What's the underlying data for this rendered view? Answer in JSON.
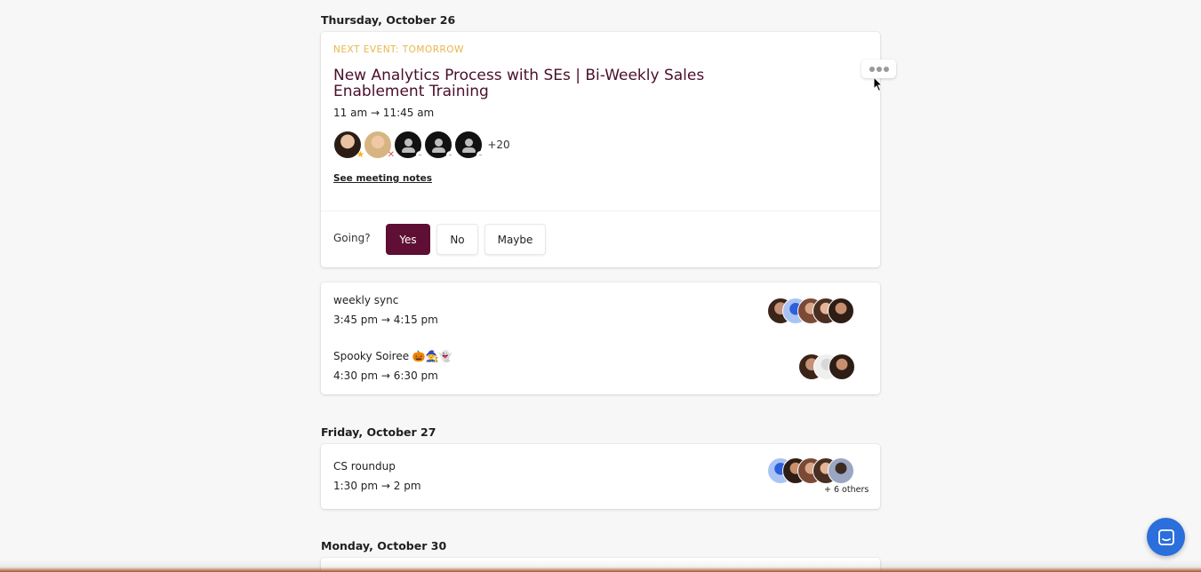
{
  "days": [
    {
      "label": "Thursday, October 26"
    },
    {
      "label": "Friday, October 27"
    },
    {
      "label": "Monday, October 30"
    }
  ],
  "featured": {
    "next_label": "NEXT EVENT: TOMORROW",
    "title": "New Analytics Process with SEs | Bi-Weekly Sales Enablement Training",
    "time": "11 am → 11:45 am",
    "more_attendees": "+20",
    "notes_link": "See meeting notes",
    "going_label": "Going?",
    "rsvp": {
      "yes": "Yes",
      "no": "No",
      "maybe": "Maybe"
    }
  },
  "thursday_events": [
    {
      "name": "weekly sync",
      "time": "3:45 pm → 4:15 pm"
    },
    {
      "name": "Spooky Soiree 🎃🧙👻",
      "time": "4:30 pm → 6:30 pm"
    }
  ],
  "friday_events": [
    {
      "name": "CS roundup",
      "time": "1:30 pm → 2 pm",
      "others": "+ 6 others"
    }
  ],
  "colors": {
    "accent": "#5e0f33",
    "next_label": "#e8b54a",
    "title": "#4a0f2a",
    "chat": "#2a6fdb"
  }
}
